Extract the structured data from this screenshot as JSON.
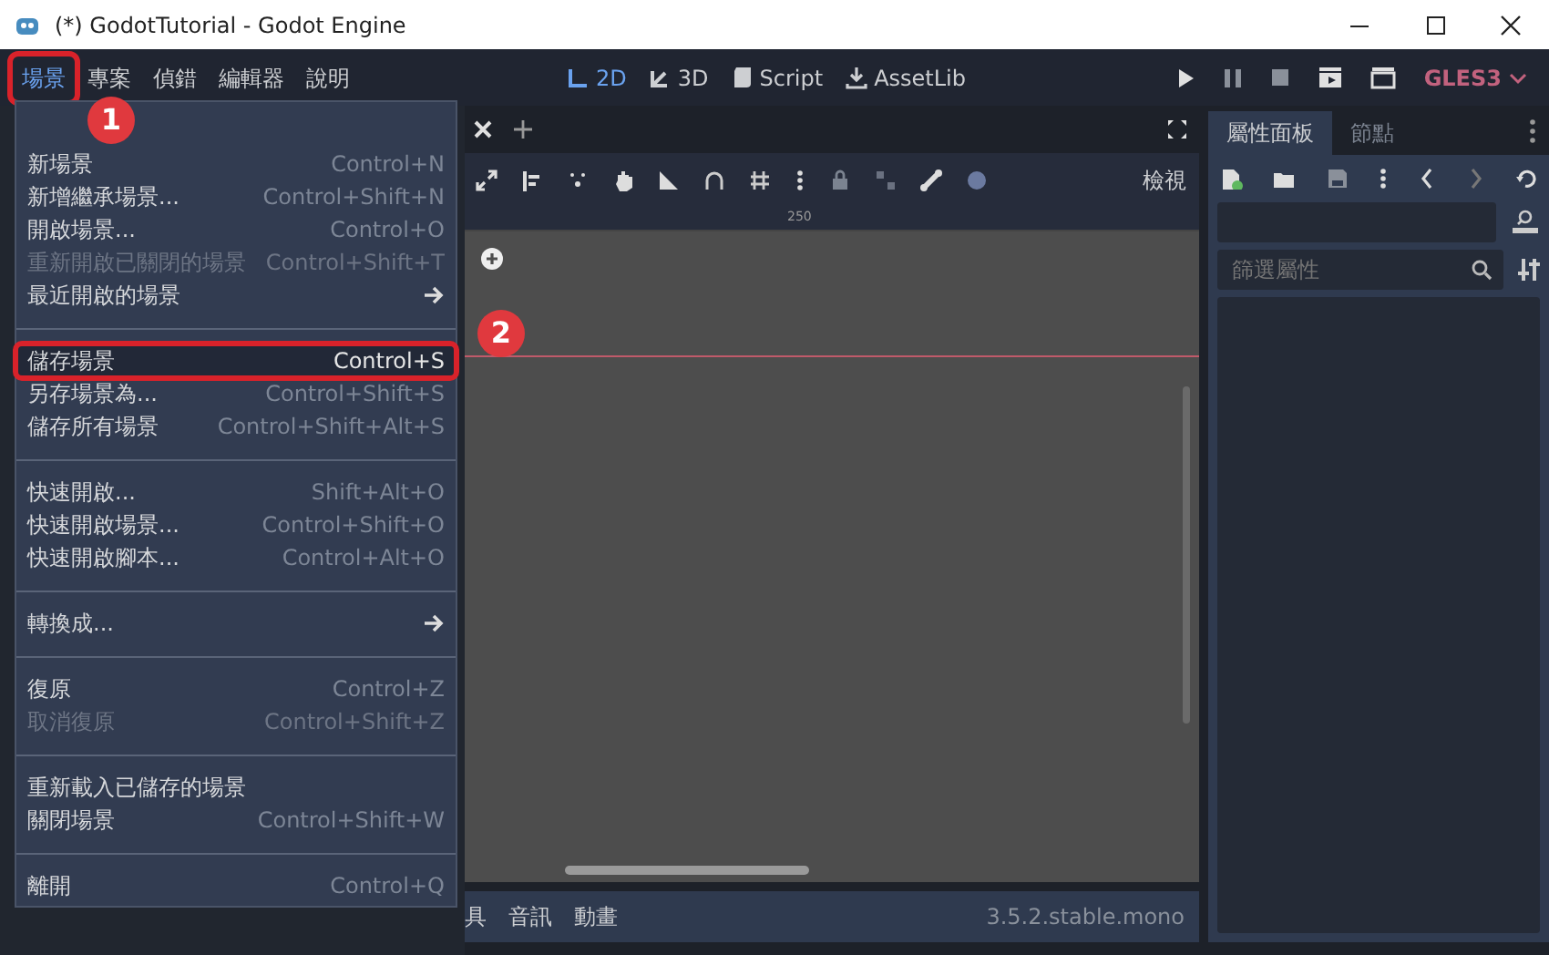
{
  "window": {
    "title": "(*) GodotTutorial - Godot Engine"
  },
  "menu_bar": [
    {
      "label": "場景",
      "selected": true
    },
    {
      "label": "專案",
      "selected": false
    },
    {
      "label": "偵錯",
      "selected": false
    },
    {
      "label": "編輯器",
      "selected": false
    },
    {
      "label": "說明",
      "selected": false
    }
  ],
  "workspaces": [
    {
      "label": "2D",
      "selected": true
    },
    {
      "label": "3D",
      "selected": false
    },
    {
      "label": "Script",
      "selected": false
    },
    {
      "label": "AssetLib",
      "selected": false
    }
  ],
  "renderer": "GLES3",
  "scene_menu": [
    {
      "kind": "item",
      "label": "新場景",
      "shortcut": "Control+N",
      "disabled": false,
      "selected": false
    },
    {
      "kind": "item",
      "label": "新增繼承場景...",
      "shortcut": "Control+Shift+N",
      "disabled": false,
      "selected": false
    },
    {
      "kind": "item",
      "label": "開啟場景...",
      "shortcut": "Control+O",
      "disabled": false,
      "selected": false
    },
    {
      "kind": "item",
      "label": "重新開啟已關閉的場景",
      "shortcut": "Control+Shift+T",
      "disabled": true,
      "selected": false
    },
    {
      "kind": "submenu",
      "label": "最近開啟的場景",
      "disabled": false,
      "selected": false
    },
    {
      "kind": "separator"
    },
    {
      "kind": "item",
      "label": "儲存場景",
      "shortcut": "Control+S",
      "disabled": false,
      "selected": true
    },
    {
      "kind": "item",
      "label": "另存場景為...",
      "shortcut": "Control+Shift+S",
      "disabled": false,
      "selected": false
    },
    {
      "kind": "item",
      "label": "儲存所有場景",
      "shortcut": "Control+Shift+Alt+S",
      "disabled": false,
      "selected": false
    },
    {
      "kind": "separator"
    },
    {
      "kind": "item",
      "label": "快速開啟...",
      "shortcut": "Shift+Alt+O",
      "disabled": false,
      "selected": false
    },
    {
      "kind": "item",
      "label": "快速開啟場景...",
      "shortcut": "Control+Shift+O",
      "disabled": false,
      "selected": false
    },
    {
      "kind": "item",
      "label": "快速開啟腳本...",
      "shortcut": "Control+Alt+O",
      "disabled": false,
      "selected": false
    },
    {
      "kind": "separator"
    },
    {
      "kind": "submenu",
      "label": "轉換成...",
      "disabled": false,
      "selected": false
    },
    {
      "kind": "separator"
    },
    {
      "kind": "item",
      "label": "復原",
      "shortcut": "Control+Z",
      "disabled": false,
      "selected": false
    },
    {
      "kind": "item",
      "label": "取消復原",
      "shortcut": "Control+Shift+Z",
      "disabled": true,
      "selected": false
    },
    {
      "kind": "separator"
    },
    {
      "kind": "item",
      "label": "重新載入已儲存的場景",
      "disabled": false,
      "selected": false
    },
    {
      "kind": "item",
      "label": "關閉場景",
      "shortcut": "Control+Shift+W",
      "disabled": false,
      "selected": false
    },
    {
      "kind": "separator"
    },
    {
      "kind": "item",
      "label": "離開",
      "shortcut": "Control+Q",
      "disabled": false,
      "selected": false
    }
  ],
  "editor": {
    "view_button": "檢視",
    "ruler_label": "250"
  },
  "bottom_panel": {
    "tabs": [
      "具",
      "音訊",
      "動畫"
    ],
    "version": "3.5.2.stable.mono"
  },
  "inspector": {
    "tabs": [
      {
        "label": "屬性面板",
        "selected": true
      },
      {
        "label": "節點",
        "selected": false
      }
    ],
    "filter": {
      "placeholder": "篩選屬性"
    }
  },
  "annotations": [
    {
      "label": "1"
    },
    {
      "label": "2"
    }
  ]
}
